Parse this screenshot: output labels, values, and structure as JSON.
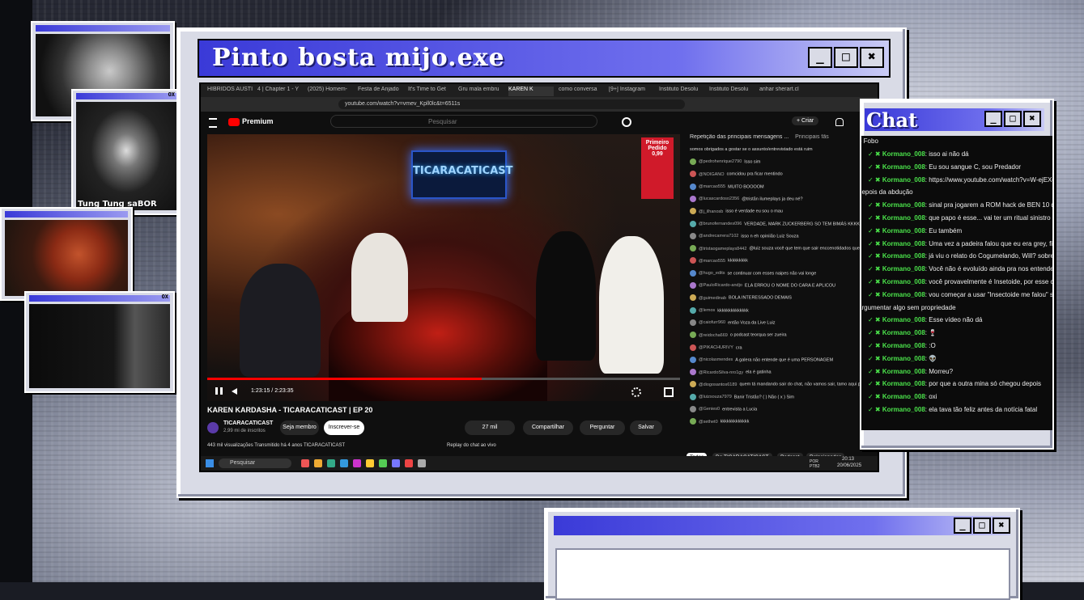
{
  "main_window": {
    "title": "Pinto bosta mijo.exe",
    "buttons": [
      "_",
      "□",
      "✖"
    ]
  },
  "browser": {
    "tabs": [
      "HIBRIDOS AUSTI",
      "4 | Chapter 1 - Y",
      "(2025) Homem-",
      "Festa de Anjado",
      "It's Time to Get",
      "Gru mala embru",
      "KAREN K",
      "como conversa",
      "[9+] Instagram",
      "Instituto Desolu",
      "Instituto Desolu",
      "anhar sherart.cl"
    ],
    "url": "youtube.com/watch?v=vmev_Kpll0lc&t=6511s"
  },
  "youtube": {
    "logo": "Premium",
    "search_placeholder": "Pesquisar",
    "create_label": "+ Criar",
    "video_title": "KAREN KARDASHA - TICARACATICAST | EP 20",
    "time": "1:23:15 / 2:23:35",
    "channel_name": "TICARACATICAST",
    "subscribers": "2,99 mi de inscritos",
    "join_label": "Seja membro",
    "subscribe_label": "Inscrever-se",
    "likes": "27 mil",
    "share_label": "Compartilhar",
    "ask_label": "Perguntar",
    "save_label": "Salvar",
    "views_line": "443 mil visualizações  Transmitido há 4 anos  TICARACATICAST",
    "replay_label": "Replay do chat ao vivo",
    "sign_text": "TICARACATICAST",
    "promo_text": "Primeiro Pedido 0,99",
    "chat_header": "Repetição das principais mensagens ...",
    "chat_pin": "Principais fãs",
    "chat_top_line": "somos obrigados a gostar se o assunto/entrevistado está ruim",
    "chat_messages": [
      {
        "user": "@pedrohenrique2790",
        "text": "Isso sim"
      },
      {
        "user": "@NOIGANO",
        "text": "comcidou pra ficar mentindo"
      },
      {
        "user": "@marcao555",
        "text": "MUITO BOOOOM"
      },
      {
        "user": "@lucascardoso2356",
        "text": "@tristãn ilumeplays ja deu né?"
      },
      {
        "user": "@j_ilhanosb",
        "text": "isso é verdade eu sou o mau"
      },
      {
        "user": "@brunofernandes096",
        "text": "VERDADE, MARK ZUCKERBERG SO TEM BIMÁS KKKKKKKKKKKK"
      },
      {
        "user": "@andrecarrera7102",
        "text": "isso n eh opiniião Luiz Souza"
      },
      {
        "user": "@tristaogameplays8442",
        "text": "@luiz souza você que tem que sair enccenotidados que so mude"
      },
      {
        "user": "@marcao555",
        "text": "kkkkkkkkk"
      },
      {
        "user": "@hugo_edits",
        "text": "se continuar com esses naipes não vai longe"
      },
      {
        "user": "@PauloRicardo-andjo",
        "text": "ELA ERROU O NOME DO CARA E APLICOU"
      },
      {
        "user": "@guimedinab",
        "text": "BOLA INTERESSADO DEMAIS"
      },
      {
        "user": "@lemos",
        "text": "kkkkkkkkkkkkkk"
      },
      {
        "user": "@caiofurr960",
        "text": "então Voza da Live Luiz"
      },
      {
        "user": "@reidocha669",
        "text": "o podcast teorqua ser zueira"
      },
      {
        "user": "@PIKACHURIVY",
        "text": "cra"
      },
      {
        "user": "@nicolasmendes",
        "text": "A galera não entende que é uma PERSONAGEM"
      },
      {
        "user": "@RicardoSilva-nro1gy",
        "text": "ela é gatinha"
      },
      {
        "user": "@diogosantos6189",
        "text": "quem tá mandando sair do chat, não vamos sair, tamo aqui por conta do bola e do Carioca, mas a convidada é zoada demais"
      },
      {
        "user": "@luizsouza7979",
        "text": "Banir Tristão? ( ) Não ( x ) Sim"
      },
      {
        "user": "@Genies0",
        "text": "entrevista a Lucia"
      },
      {
        "user": "@sethet0",
        "text": "kkkkkkkkkkkkk"
      }
    ],
    "chips": [
      "Todos",
      "De TICARACATICAST",
      "Podcast",
      "Relacionados"
    ],
    "taskbar_search": "Pesquisar",
    "clock": "20:13",
    "date": "20/06/2025",
    "lang": "POR PTB2"
  },
  "chat_window": {
    "title": "Chat",
    "buttons": [
      "_",
      "□",
      "✖"
    ],
    "top_fragment": "o Fobo",
    "messages": [
      {
        "user": "Kormano_008",
        "text": "isso ai não dá"
      },
      {
        "user": "Kormano_008",
        "text": "Eu sou sangue C, sou Predador"
      },
      {
        "user": "Kormano_008",
        "text": "https://www.youtube.com/watch?v=W-ejEXomw"
      },
      {
        "user": "",
        "text": "depois da abdução"
      },
      {
        "user": "Kormano_008",
        "text": "sinal pra jogarem a ROM hack de BEN 10 de Po"
      },
      {
        "user": "Kormano_008",
        "text": "que papo é esse... vai ter um ritual sinistro"
      },
      {
        "user": "Kormano_008",
        "text": "Eu também"
      },
      {
        "user": "Kormano_008",
        "text": "Uma vez a padeira falou que eu era grey, ficou"
      },
      {
        "user": "Kormano_008",
        "text": "já viu o relato do Cogumelando, Will? sobre ET"
      },
      {
        "user": "Kormano_008",
        "text": "Você não é evoluído ainda pra nos entender, Ma"
      },
      {
        "user": "Kormano_008",
        "text": "você provavelmente é Insetoide, por esse come"
      },
      {
        "user": "Kormano_008",
        "text": "vou começar a usar \"Insectoide me falou\" semp"
      },
      {
        "user": "",
        "text": "argumentar algo sem propriedade"
      },
      {
        "user": "Kormano_008",
        "text": "Esse vídeo não dá"
      },
      {
        "user": "Kormano_008",
        "text": "🍷"
      },
      {
        "user": "Kormano_008",
        "text": ":O"
      },
      {
        "user": "Kormano_008",
        "text": "👽"
      },
      {
        "user": "Kormano_008",
        "text": "Morreu?"
      },
      {
        "user": "Kormano_008",
        "text": "por que a outra mina só chegou depois"
      },
      {
        "user": "Kormano_008",
        "text": "oxi"
      },
      {
        "user": "Kormano_008",
        "text": "ela tava tão feliz antes da notícia fatal"
      }
    ]
  },
  "side_windows": {
    "caption": "Tung Tung saBOR",
    "close_glyph": "OX"
  },
  "bottom_window": {
    "buttons": [
      "_",
      "□",
      "✖"
    ]
  },
  "colors": {
    "title_blue": "#3a3ad8",
    "chat_green": "#4be34b",
    "yt_red": "#ff0000"
  }
}
